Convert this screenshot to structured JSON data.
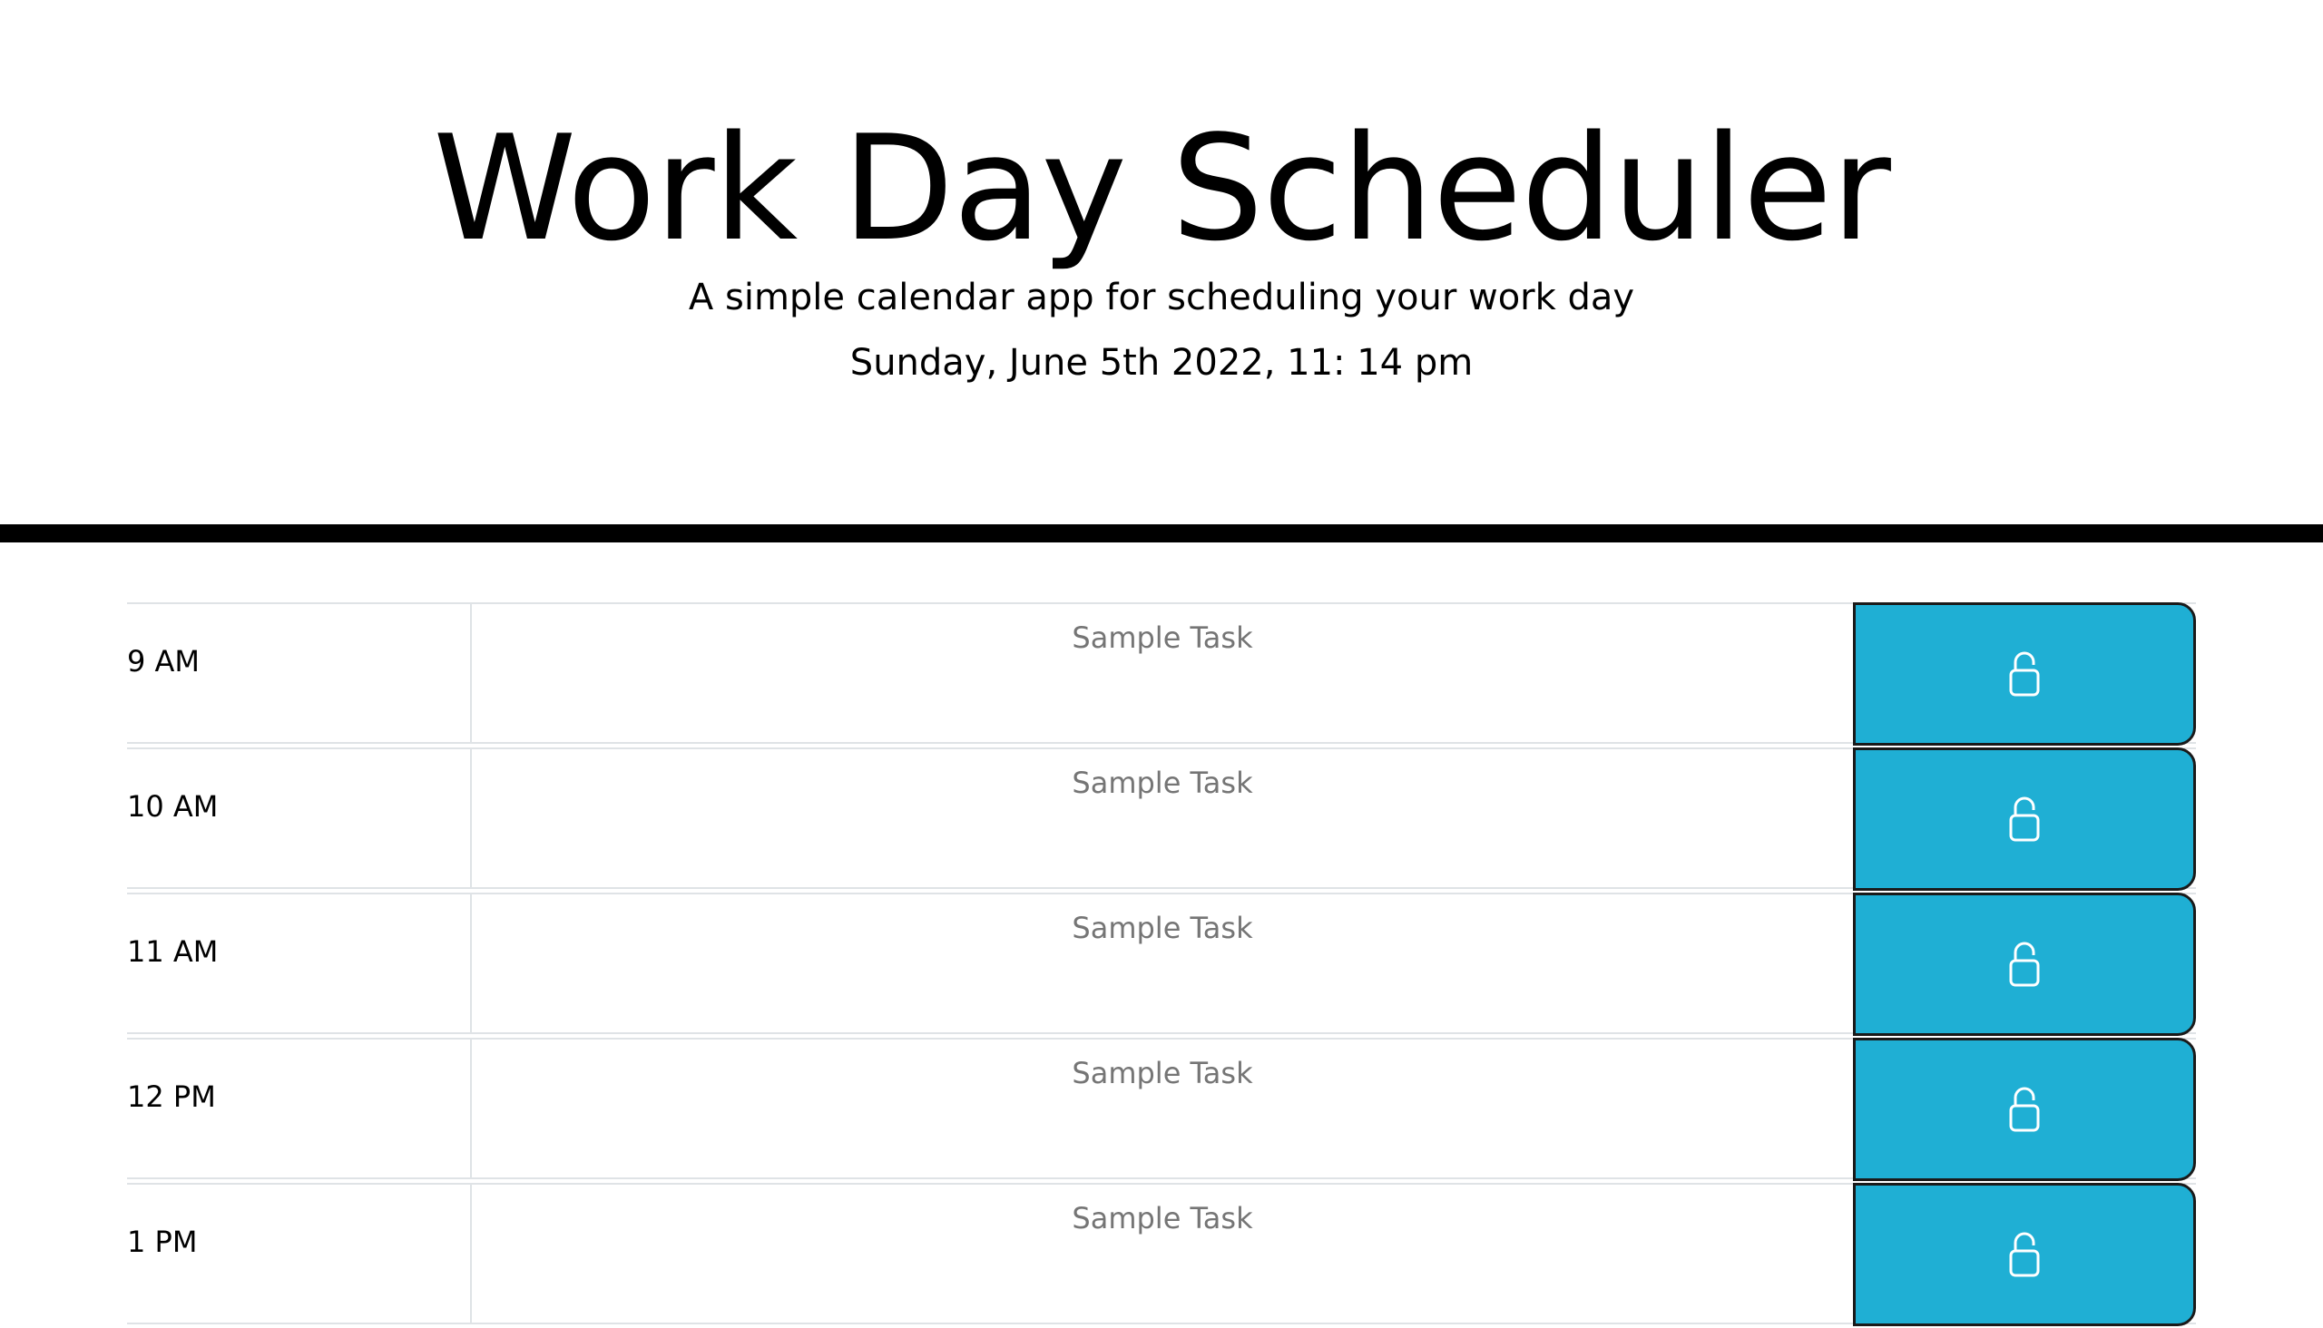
{
  "header": {
    "title": "Work Day Scheduler",
    "lead": "A simple calendar app for scheduling your work day",
    "current_day": "Sunday, June 5th 2022, 11: 14 pm"
  },
  "colors": {
    "accent": "#1fafd4",
    "divider": "#000000",
    "row_border": "#dfe3e6"
  },
  "rows": [
    {
      "hour": "9 AM",
      "task": "Sample Task",
      "icon": "lock-icon"
    },
    {
      "hour": "10 AM",
      "task": "Sample Task",
      "icon": "lock-icon"
    },
    {
      "hour": "11 AM",
      "task": "Sample Task",
      "icon": "lock-icon"
    },
    {
      "hour": "12 PM",
      "task": "Sample Task",
      "icon": "lock-icon"
    },
    {
      "hour": "1 PM",
      "task": "Sample Task",
      "icon": "lock-icon"
    }
  ]
}
